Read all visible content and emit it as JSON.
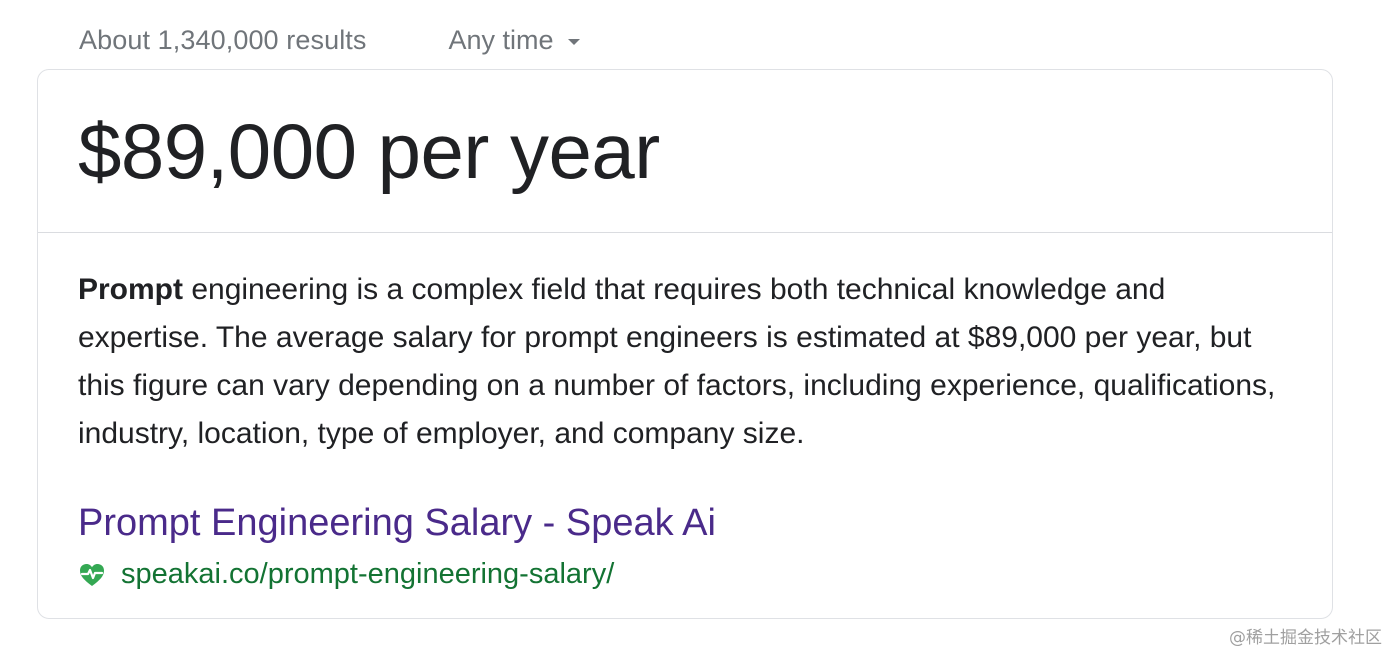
{
  "search_meta": {
    "results_count": "About 1,340,000 results",
    "time_filter": "Any time"
  },
  "featured_snippet": {
    "answer": "$89,000 per year",
    "snippet_bold": "Prompt",
    "snippet_rest": " engineering is a complex field that requires both technical knowledge and expertise. The average salary for prompt engineers is estimated at $89,000 per year, but this figure can vary depending on a number of factors, including experience, qualifications, industry, location, type of employer, and company size.",
    "source_title": "Prompt Engineering Salary - Speak Ai",
    "source_url": "speakai.co/prompt-engineering-salary/",
    "favicon": "heart-pulse-icon"
  },
  "colors": {
    "link_title": "#4a2a8a",
    "url_green": "#137333",
    "favicon_green": "#34a853"
  },
  "watermark": "@稀土掘金技术社区"
}
